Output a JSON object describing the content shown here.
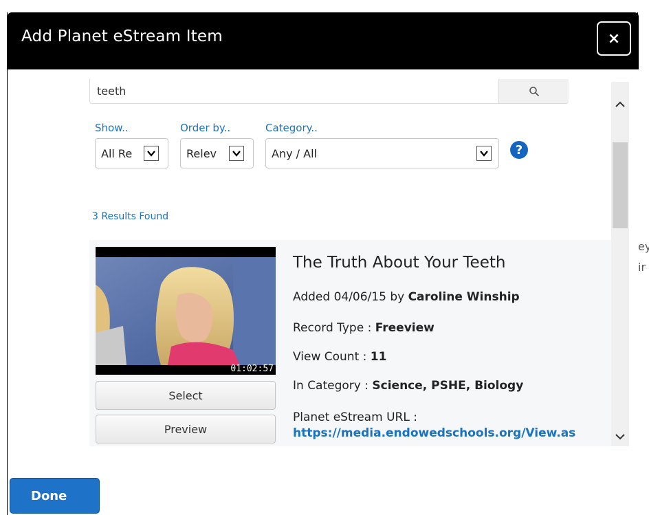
{
  "dialog": {
    "title": "Add Planet eStream Item",
    "close_label": "×"
  },
  "search": {
    "value": "teeth",
    "button_icon": "search-icon"
  },
  "filters": {
    "show": {
      "label": "Show..",
      "selected": "All Re"
    },
    "order": {
      "label": "Order by..",
      "selected": "Relev"
    },
    "category": {
      "label": "Category..",
      "selected": "Any / All"
    },
    "help_label": "?"
  },
  "results": {
    "count_text": "3 Results Found",
    "items": [
      {
        "title": "The Truth About Your Teeth",
        "added_prefix": "Added 04/06/15 by ",
        "added_by": "Caroline Winship",
        "record_type_label": "Record Type : ",
        "record_type": "Freeview",
        "view_count_label": "View Count : ",
        "view_count": "11",
        "category_label": "In Category : ",
        "category": "Science, PSHE, Biology",
        "url_label": "Planet eStream URL :",
        "url": "https://media.endowedschools.org/View.as",
        "url_cont": "                              ",
        "duration": "01:02:57",
        "select_label": "Select",
        "preview_label": "Preview"
      }
    ]
  },
  "footer": {
    "done_label": "Done"
  },
  "colors": {
    "titlebar": "#000000",
    "link_blue": "#1a73c0",
    "done_button": "#1e73c8",
    "help_icon": "#1565c0"
  }
}
